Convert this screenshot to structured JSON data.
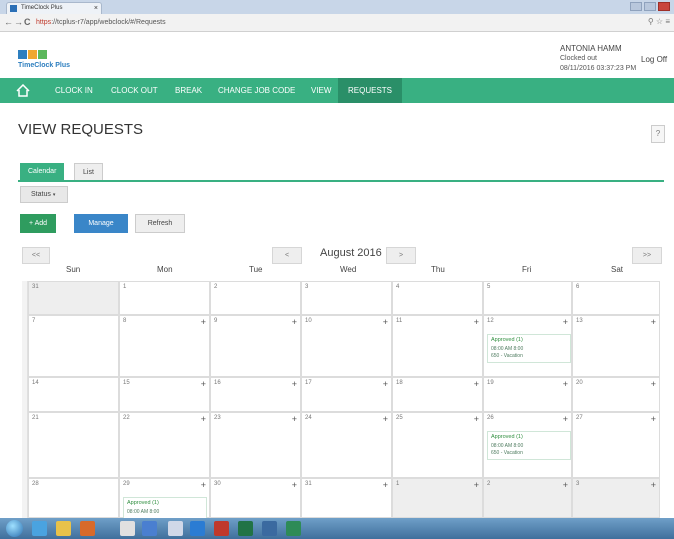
{
  "browser": {
    "tab_title": "TimeClock Plus",
    "url_https": "https",
    "url_rest": "://tcplus-r7/app/webclock/#/Requests",
    "back": "←",
    "forward": "→",
    "reload": "C",
    "right_icons": "⚲ ☆ ≡"
  },
  "app": {
    "logo_text": "TimeClock Plus",
    "logo_colors": [
      "#2e7fbf",
      "#f0a830",
      "#5cb85c"
    ],
    "user_name": "ANTONIA HAMM",
    "status": "Clocked out",
    "datetime": "08/11/2016 03:37:23 PM",
    "logoff": "Log Off"
  },
  "nav": {
    "items": [
      "CLOCK IN",
      "CLOCK OUT",
      "BREAK",
      "CHANGE JOB CODE",
      "VIEW",
      "REQUESTS"
    ],
    "accent": "#39b082"
  },
  "page": {
    "title": "VIEW REQUESTS",
    "help": "?",
    "tabs": [
      "Calendar",
      "List"
    ],
    "status_label": "Status",
    "add_label": "+ Add",
    "manage_label": "Manage",
    "refresh_label": "Refresh"
  },
  "calendar": {
    "prev_prev": "<<",
    "prev": "<",
    "month": "August 2016",
    "next": ">",
    "next_next": ">>",
    "days": [
      "Sun",
      "Mon",
      "Tue",
      "Wed",
      "Thu",
      "Fri",
      "Sat"
    ],
    "weeks": [
      [
        "31",
        "1",
        "2",
        "3",
        "4",
        "5",
        "6"
      ],
      [
        "7",
        "8",
        "9",
        "10",
        "11",
        "12",
        "13"
      ],
      [
        "14",
        "15",
        "16",
        "17",
        "18",
        "19",
        "20"
      ],
      [
        "21",
        "22",
        "23",
        "24",
        "25",
        "26",
        "27"
      ],
      [
        "28",
        "29",
        "30",
        "31",
        "1",
        "2",
        "3"
      ]
    ],
    "event_title": "Approved (1)",
    "event_time": "08:00 AM 8:00",
    "event_code": "650 - Vacation"
  }
}
